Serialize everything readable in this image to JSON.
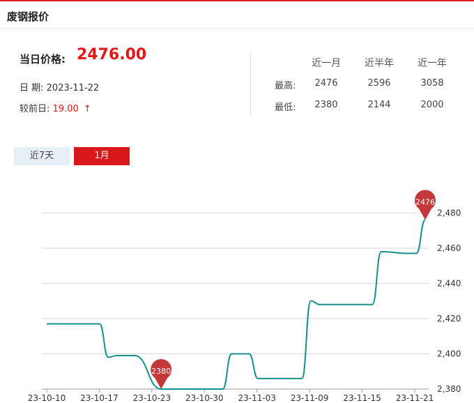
{
  "header": {
    "title": "废钢报价"
  },
  "summary": {
    "price_label": "当日价格:",
    "price_value": "2476.00",
    "date_label": "日 期:",
    "date_value": "2023-11-22",
    "change_label": "较前日:",
    "change_value": "19.00",
    "change_arrow": "↑"
  },
  "stats": {
    "headers": [
      "近一月",
      "近半年",
      "近一年"
    ],
    "rows": [
      {
        "label": "最高:",
        "values": [
          "2476",
          "2596",
          "3058"
        ]
      },
      {
        "label": "最低:",
        "values": [
          "2380",
          "2144",
          "2000"
        ]
      }
    ]
  },
  "tabs": [
    {
      "label": "近7天",
      "active": false
    },
    {
      "label": "1月",
      "active": true
    }
  ],
  "colors": {
    "line": "#16908c",
    "pin": "#c4383c",
    "accent": "#e01818",
    "grid": "#d9d9d9"
  },
  "chart_data": {
    "type": "line",
    "title": "",
    "xlabel": "",
    "ylabel": "",
    "ylim": [
      2380,
      2490
    ],
    "y_ticks": [
      2380,
      2400,
      2420,
      2440,
      2460,
      2480
    ],
    "y_tick_labels": [
      "2,380",
      "2,400",
      "2,420",
      "2,440",
      "2,460",
      "2,480"
    ],
    "x_ticks": [
      "23-10-10",
      "23-10-17",
      "23-10-23",
      "23-10-30",
      "23-11-03",
      "23-11-09",
      "23-11-15",
      "23-11-21"
    ],
    "grid": true,
    "series": [
      {
        "x": [
          "2023-10-10",
          "2023-10-11",
          "2023-10-12",
          "2023-10-13",
          "2023-10-16",
          "2023-10-17",
          "2023-10-18",
          "2023-10-19",
          "2023-10-20",
          "2023-10-23",
          "2023-10-24",
          "2023-10-25",
          "2023-10-26",
          "2023-10-27",
          "2023-10-30",
          "2023-10-31",
          "2023-11-01",
          "2023-11-02",
          "2023-11-03",
          "2023-11-06",
          "2023-11-07",
          "2023-11-08",
          "2023-11-09",
          "2023-11-10",
          "2023-11-13",
          "2023-11-14",
          "2023-11-15",
          "2023-11-16",
          "2023-11-17",
          "2023-11-20",
          "2023-11-21",
          "2023-11-22"
        ],
        "values": [
          2417,
          2417,
          2417,
          2417,
          2417,
          2398,
          2399,
          2399,
          2399,
          2380,
          2380,
          2380,
          2380,
          2380,
          2380,
          2400,
          2400,
          2400,
          2386,
          2386,
          2386,
          2386,
          2430,
          2428,
          2428,
          2428,
          2428,
          2428,
          2458,
          2457,
          2457,
          2476
        ]
      }
    ],
    "markers": [
      {
        "label": "2380",
        "value": 2380,
        "date": "2023-10-23"
      },
      {
        "label": "2476",
        "value": 2476,
        "date": "2023-11-22"
      }
    ]
  }
}
